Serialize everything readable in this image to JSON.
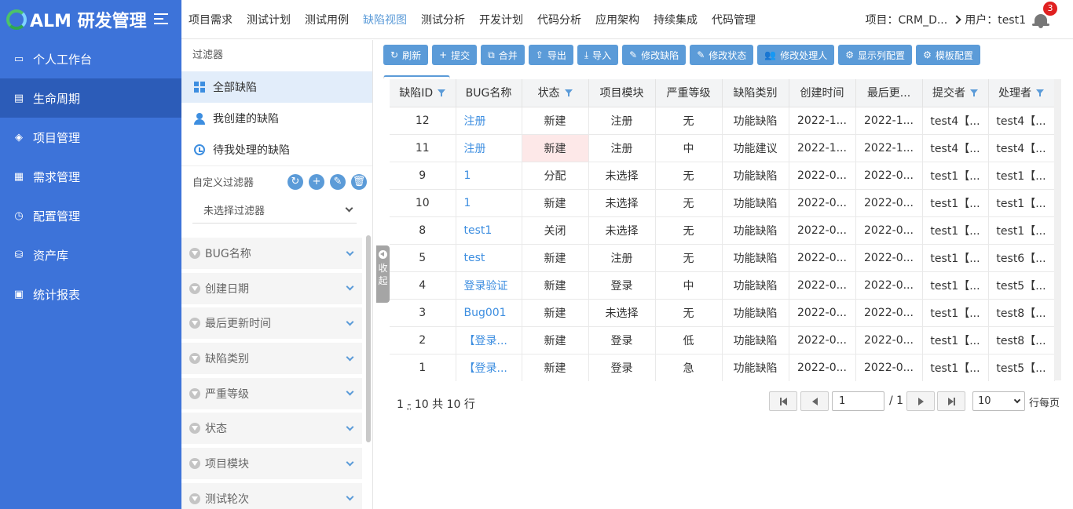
{
  "app": {
    "title": "ALM 研发管理"
  },
  "sidebar": {
    "items": [
      {
        "label": "个人工作台",
        "icon": "monitor-icon"
      },
      {
        "label": "生命周期",
        "icon": "lifecycle-icon",
        "active": true
      },
      {
        "label": "项目管理",
        "icon": "layers-icon"
      },
      {
        "label": "需求管理",
        "icon": "requirement-icon"
      },
      {
        "label": "配置管理",
        "icon": "clock-icon"
      },
      {
        "label": "资产库",
        "icon": "database-icon"
      },
      {
        "label": "统计报表",
        "icon": "report-icon"
      }
    ]
  },
  "topnav": {
    "items": [
      "项目需求",
      "测试计划",
      "测试用例",
      "缺陷视图",
      "测试分析",
      "开发计划",
      "代码分析",
      "应用架构",
      "持续集成",
      "代码管理"
    ],
    "active": "缺陷视图",
    "project": "项目：CRM_D...",
    "user": "用户：test1",
    "notification_count": "3"
  },
  "filters": {
    "title": "过滤器",
    "items": [
      "全部缺陷",
      "我创建的缺陷",
      "待我处理的缺陷"
    ],
    "custom_label": "自定义过滤器",
    "select_value": "未选择过滤器",
    "accordions": [
      "BUG名称",
      "创建日期",
      "最后更新时间",
      "缺陷类别",
      "严重等级",
      "状态",
      "项目模块",
      "测试轮次"
    ],
    "collapse_label_1": "收",
    "collapse_label_2": "起"
  },
  "toolbar": {
    "buttons": [
      {
        "label": "刷新",
        "icon": "refresh-icon",
        "glyph": "↻"
      },
      {
        "label": "提交",
        "icon": "plus-icon",
        "glyph": "+"
      },
      {
        "label": "合并",
        "icon": "copy-icon",
        "glyph": "⧉"
      },
      {
        "label": "导出",
        "icon": "upload-icon",
        "glyph": "⇪"
      },
      {
        "label": "导入",
        "icon": "download-icon",
        "glyph": "⤓"
      },
      {
        "label": "修改缺陷",
        "icon": "edit-icon",
        "glyph": "✎"
      },
      {
        "label": "修改状态",
        "icon": "edit-icon",
        "glyph": "✎"
      },
      {
        "label": "修改处理人",
        "icon": "users-icon",
        "glyph": "👥"
      },
      {
        "label": "显示列配置",
        "icon": "gear-icon",
        "glyph": "⚙"
      },
      {
        "label": "模板配置",
        "icon": "gear-icon",
        "glyph": "⚙"
      }
    ]
  },
  "table": {
    "columns": [
      {
        "label": "缺陷ID",
        "filter": true
      },
      {
        "label": "BUG名称",
        "filter": false
      },
      {
        "label": "状态",
        "filter": true
      },
      {
        "label": "项目模块",
        "filter": false
      },
      {
        "label": "严重等级",
        "filter": false
      },
      {
        "label": "缺陷类别",
        "filter": false
      },
      {
        "label": "创建时间",
        "filter": false
      },
      {
        "label": "最后更...",
        "filter": false
      },
      {
        "label": "提交者",
        "filter": true
      },
      {
        "label": "处理者",
        "filter": true
      }
    ],
    "rows": [
      [
        "12",
        "注册",
        "新建",
        "注册",
        "无",
        "功能缺陷",
        "2022-1...",
        "2022-1...",
        "test4【...",
        "test4【..."
      ],
      [
        "11",
        "注册",
        "新建",
        "注册",
        "中",
        "功能建议",
        "2022-1...",
        "2022-1...",
        "test4【...",
        "test4【..."
      ],
      [
        "9",
        "1",
        "分配",
        "未选择",
        "无",
        "功能缺陷",
        "2022-0...",
        "2022-0...",
        "test1【...",
        "test1【..."
      ],
      [
        "10",
        "1",
        "新建",
        "未选择",
        "无",
        "功能缺陷",
        "2022-0...",
        "2022-0...",
        "test1【...",
        "test1【..."
      ],
      [
        "8",
        "test1",
        "关闭",
        "未选择",
        "无",
        "功能缺陷",
        "2022-0...",
        "2022-0...",
        "test1【...",
        "test1【..."
      ],
      [
        "5",
        "test",
        "新建",
        "注册",
        "无",
        "功能缺陷",
        "2022-0...",
        "2022-0...",
        "test1【...",
        "test6【..."
      ],
      [
        "4",
        "登录验证",
        "新建",
        "登录",
        "中",
        "功能缺陷",
        "2022-0...",
        "2022-0...",
        "test1【...",
        "test5【..."
      ],
      [
        "3",
        "Bug001",
        "新建",
        "未选择",
        "无",
        "功能缺陷",
        "2022-0...",
        "2022-0...",
        "test1【...",
        "test8【..."
      ],
      [
        "2",
        "【登录...",
        "新建",
        "登录",
        "低",
        "功能缺陷",
        "2022-0...",
        "2022-0...",
        "test1【...",
        "test8【..."
      ],
      [
        "1",
        "【登录...",
        "新建",
        "登录",
        "急",
        "功能缺陷",
        "2022-0...",
        "2022-0...",
        "test1【...",
        "test5【..."
      ]
    ],
    "highlight_cell": {
      "row": 1,
      "col": 2
    }
  },
  "pager": {
    "info_prefix": "1",
    "info_dash": "-",
    "info_suffix": "10 共 10 行",
    "page_value": "1",
    "total_pages": "/ 1",
    "page_size": "10",
    "page_size_label": "行每页"
  },
  "colors": {
    "sidebar": "#3d73d9",
    "sidebar_active": "#2c5cb8",
    "accent": "#5b9bd8",
    "link": "#3d8ee0",
    "highlight": "#fde8e8"
  }
}
